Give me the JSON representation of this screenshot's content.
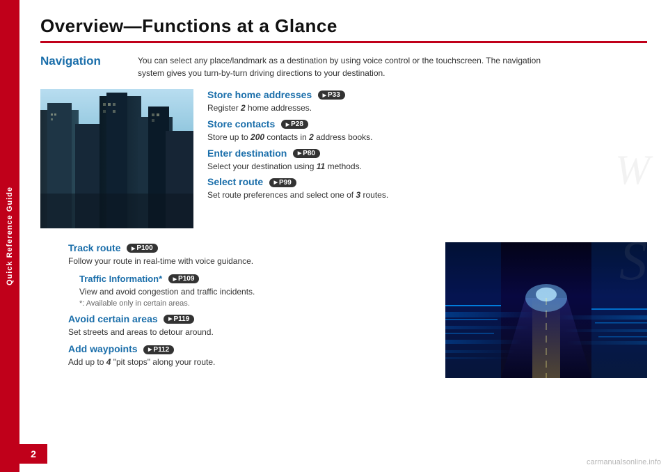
{
  "sidebar": {
    "label": "Quick Reference Guide"
  },
  "page": {
    "title": "Overview—Functions at a Glance",
    "number": "2"
  },
  "navigation": {
    "label": "Navigation",
    "description": "You can select any place/landmark as a destination by using voice control or the touchscreen. The navigation system gives you turn-by-turn driving directions to your destination."
  },
  "features_upper": [
    {
      "title": "Store home addresses",
      "ref": "P33",
      "description": "Register 2 home addresses.",
      "desc_bold": "2"
    },
    {
      "title": "Store contacts",
      "ref": "P28",
      "description": "Store up to 200 contacts in 2 address books.",
      "desc_bold": "200"
    },
    {
      "title": "Enter destination",
      "ref": "P80",
      "description": "Select your destination using 11 methods.",
      "desc_bold": "11"
    },
    {
      "title": "Select route",
      "ref": "P99",
      "description": "Set route preferences and select one of 3 routes.",
      "desc_bold": "3"
    }
  ],
  "features_lower": [
    {
      "title": "Track route",
      "ref": "P100",
      "description": "Follow your route in real-time with voice guidance.",
      "indent": false
    },
    {
      "title": "Traffic Information*",
      "ref": "P109",
      "description": "View and avoid congestion and traffic incidents.",
      "footnote": "*: Available only in certain areas.",
      "indent": true
    },
    {
      "title": "Avoid certain areas",
      "ref": "P119",
      "description": "Set streets and areas to detour around.",
      "indent": false
    },
    {
      "title": "Add waypoints",
      "ref": "P112",
      "description": "Add up to 4 \"pit stops\" along your route.",
      "desc_bold": "4",
      "indent": false
    }
  ],
  "watermark": "carmanualsonline.info"
}
